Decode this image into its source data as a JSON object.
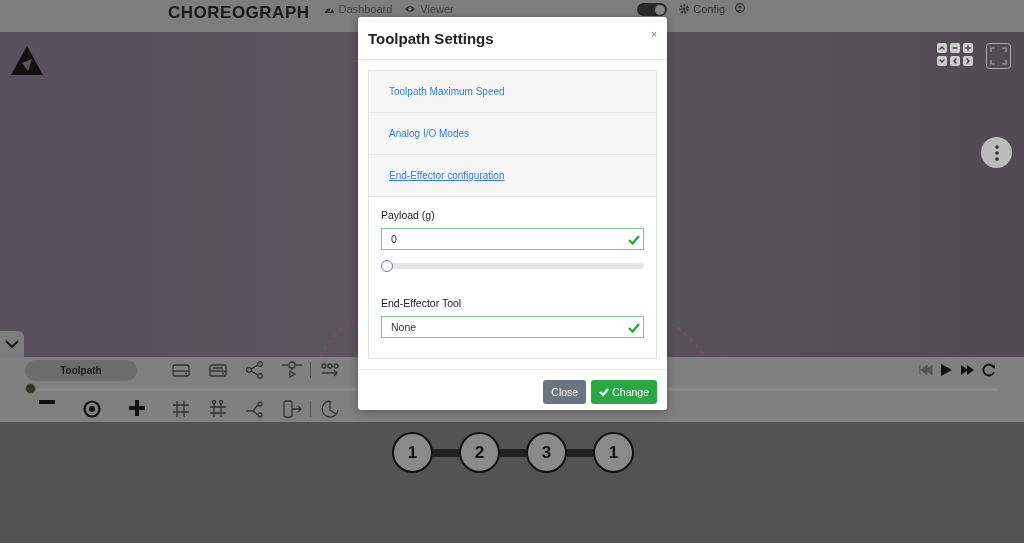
{
  "nav": {
    "brand": "CHOREOGRAPH",
    "links": [
      {
        "label": "Dashboard"
      },
      {
        "label": "Viewer"
      }
    ],
    "toggle": {
      "on": true
    },
    "config": "Config"
  },
  "toolbar": {
    "mode": "Toolpath",
    "timeline": {
      "level": 0
    }
  },
  "steps": [
    "1",
    "2",
    "3",
    "1"
  ],
  "modal": {
    "title": "Toolpath Settings",
    "close_symbol": "×",
    "sections": [
      {
        "label": "Toolpath Maximum Speed",
        "expanded": false
      },
      {
        "label": "Analog I/O Modes",
        "expanded": false
      },
      {
        "label": "End-Effector configuration",
        "expanded": true
      }
    ],
    "payload": {
      "label": "Payload (g)",
      "value": "0",
      "valid": true,
      "level": 0
    },
    "tool": {
      "label": "End-Effector Tool",
      "value": "None",
      "valid": true
    },
    "buttons": [
      {
        "label": "Close",
        "kind": "secondary"
      },
      {
        "label": "Change",
        "kind": "primary"
      }
    ]
  }
}
